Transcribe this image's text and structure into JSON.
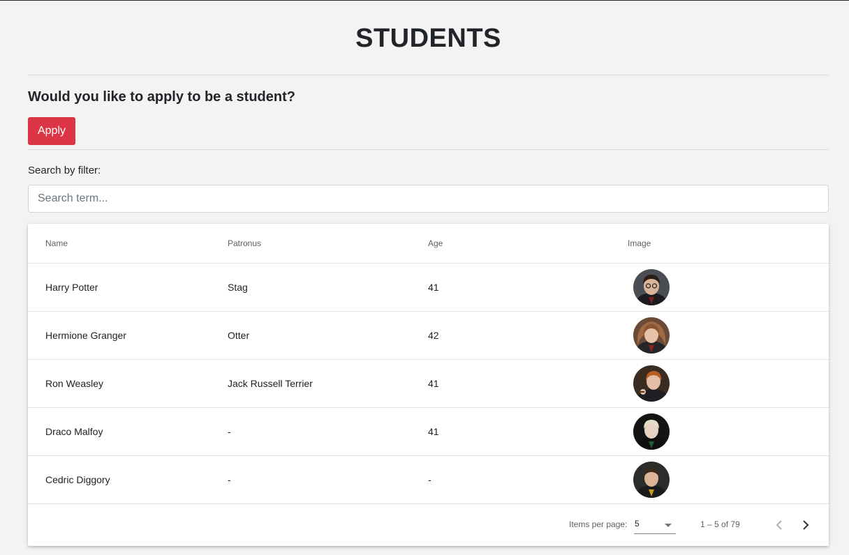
{
  "page": {
    "title": "STUDENTS"
  },
  "apply": {
    "question": "Would you like to apply to be a student?",
    "button_label": "Apply",
    "button_color": "#dc3545"
  },
  "search": {
    "label": "Search by filter:",
    "placeholder": "Search term...",
    "value": ""
  },
  "table": {
    "columns": [
      "Name",
      "Patronus",
      "Age",
      "Image"
    ],
    "rows": [
      {
        "name": "Harry Potter",
        "patronus": "Stag",
        "age": "41"
      },
      {
        "name": "Hermione Granger",
        "patronus": "Otter",
        "age": "42"
      },
      {
        "name": "Ron Weasley",
        "patronus": "Jack Russell Terrier",
        "age": "41"
      },
      {
        "name": "Draco Malfoy",
        "patronus": "-",
        "age": "41"
      },
      {
        "name": "Cedric Diggory",
        "patronus": "-",
        "age": "-"
      }
    ]
  },
  "paginator": {
    "items_per_page_label": "Items per page:",
    "page_size": "5",
    "range_label": "1 – 5 of 79"
  },
  "icons": {
    "prev": "chevron-left-icon",
    "next": "chevron-right-icon",
    "select": "caret-down-icon"
  }
}
